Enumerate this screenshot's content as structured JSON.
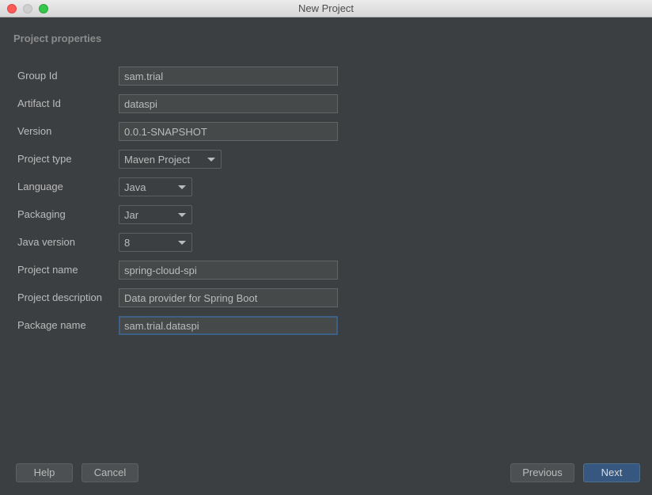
{
  "window": {
    "title": "New Project"
  },
  "section": {
    "title": "Project properties"
  },
  "form": {
    "group_id": {
      "label": "Group Id",
      "value": "sam.trial"
    },
    "artifact_id": {
      "label": "Artifact Id",
      "value": "dataspi"
    },
    "version": {
      "label": "Version",
      "value": "0.0.1-SNAPSHOT"
    },
    "project_type": {
      "label": "Project type",
      "value": "Maven Project"
    },
    "language": {
      "label": "Language",
      "value": "Java"
    },
    "packaging": {
      "label": "Packaging",
      "value": "Jar"
    },
    "java_version": {
      "label": "Java version",
      "value": "8"
    },
    "project_name": {
      "label": "Project name",
      "value": "spring-cloud-spi"
    },
    "project_description": {
      "label": "Project description",
      "value": "Data provider for Spring Boot"
    },
    "package_name": {
      "label": "Package name",
      "value": "sam.trial.dataspi"
    }
  },
  "buttons": {
    "help": "Help",
    "cancel": "Cancel",
    "previous": "Previous",
    "next": "Next"
  },
  "colors": {
    "background": "#3c3f41",
    "field_background": "#45494a",
    "text": "#bbbbbb",
    "focus_border": "#3d6185",
    "primary_button": "#365880"
  },
  "icons": {
    "dropdown": "chevron-down-icon"
  }
}
